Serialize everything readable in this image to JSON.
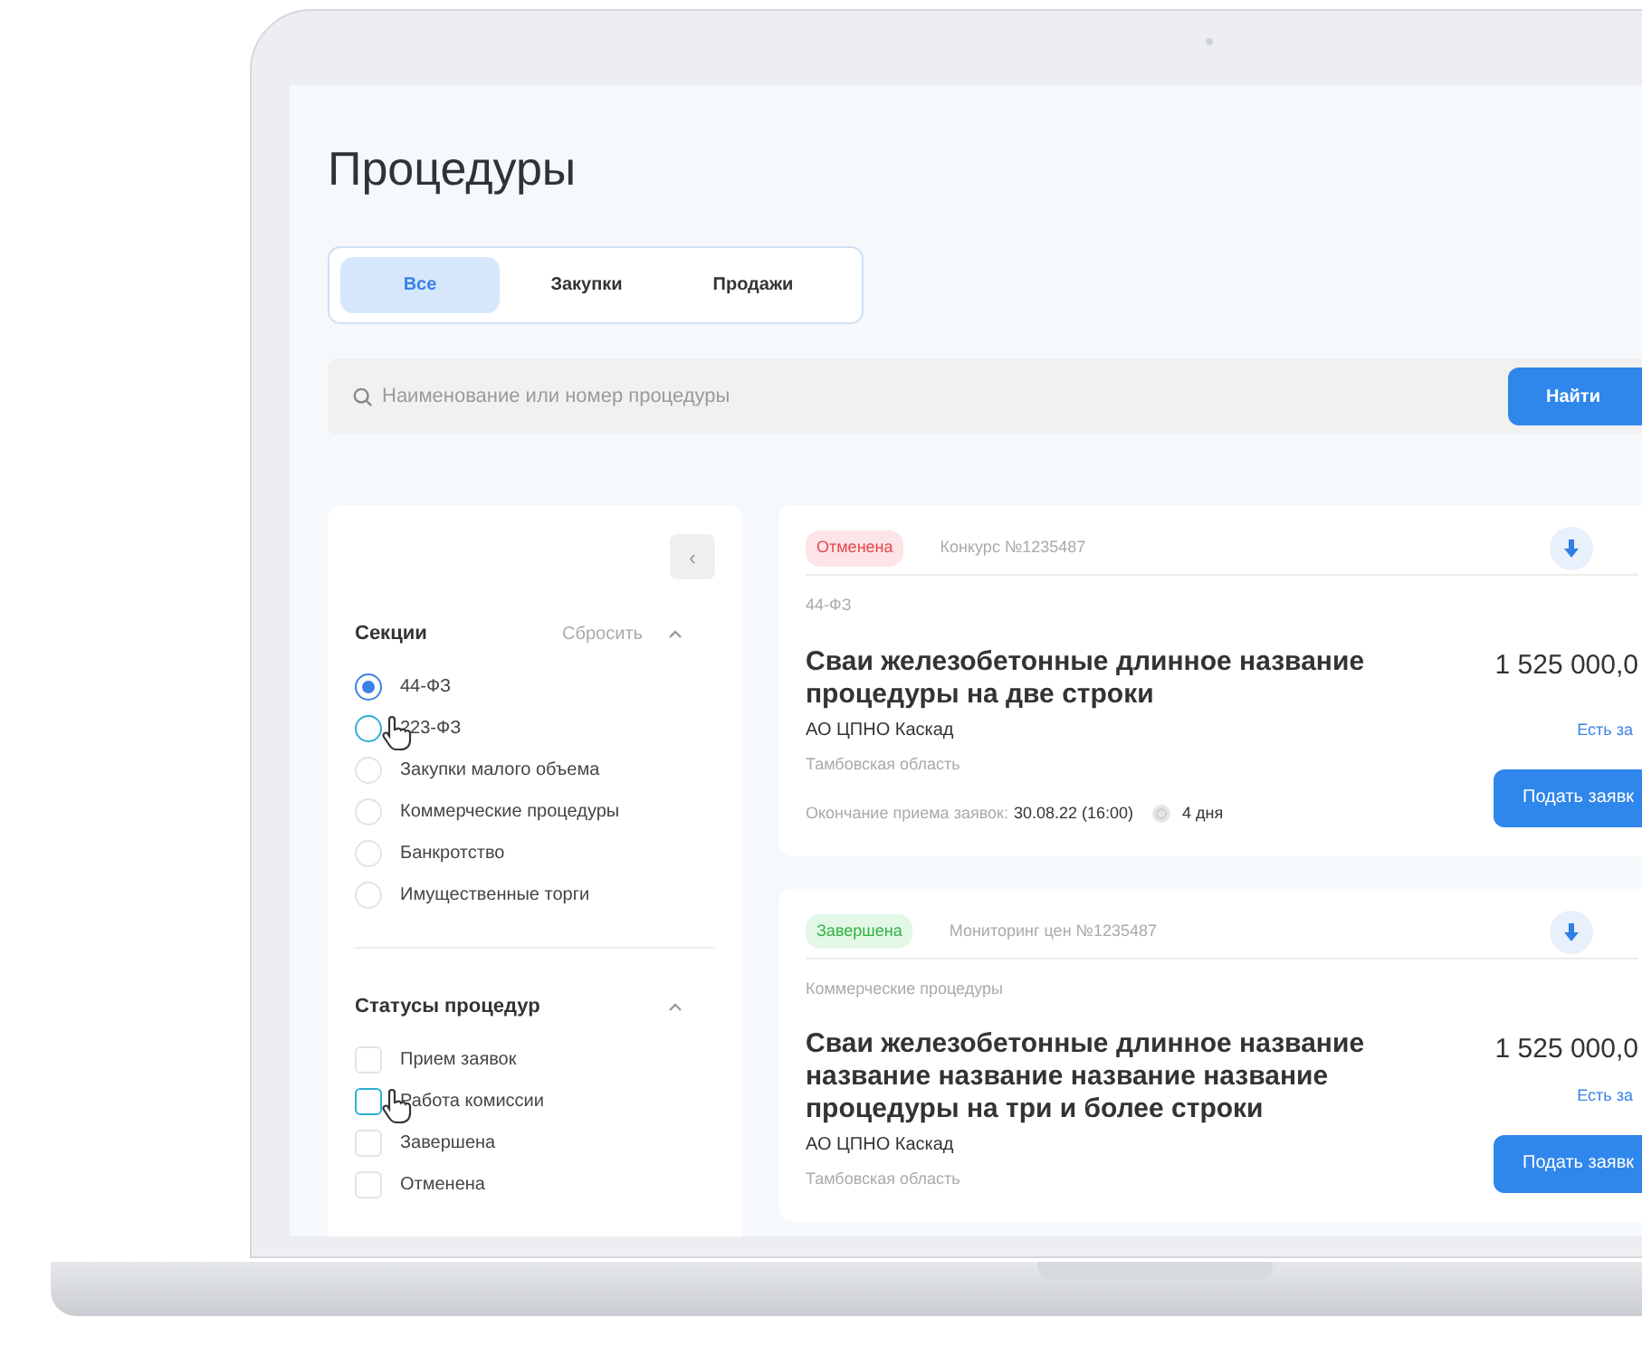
{
  "page": {
    "title": "Процедуры"
  },
  "tabs": [
    {
      "label": "Все",
      "selected": true
    },
    {
      "label": "Закупки",
      "selected": false
    },
    {
      "label": "Продажи",
      "selected": false
    }
  ],
  "search": {
    "placeholder": "Наименование или номер процедуры",
    "button": "Найти"
  },
  "filters": {
    "collapse_button": "‹",
    "sections": [
      {
        "title": "Секции",
        "reset": "Сбросить",
        "kind": "radio",
        "expanded": true,
        "items": [
          {
            "label": "44-ФЗ",
            "selected": true,
            "hovered": false
          },
          {
            "label": "223-ФЗ",
            "selected": false,
            "hovered": true
          },
          {
            "label": "Закупки малого объема",
            "selected": false,
            "hovered": false
          },
          {
            "label": "Коммерческие процедуры",
            "selected": false,
            "hovered": false
          },
          {
            "label": "Банкротство",
            "selected": false,
            "hovered": false
          },
          {
            "label": "Имущественные торги",
            "selected": false,
            "hovered": false
          }
        ]
      },
      {
        "title": "Статусы процедур",
        "kind": "checkbox",
        "expanded": true,
        "items": [
          {
            "label": "Прием заявок",
            "checked": false,
            "hovered": false
          },
          {
            "label": "Работа комиссии",
            "checked": false,
            "hovered": true
          },
          {
            "label": "Завершена",
            "checked": false,
            "hovered": false
          },
          {
            "label": "Отменена",
            "checked": false,
            "hovered": false
          }
        ]
      }
    ]
  },
  "procedures": [
    {
      "status": "Отменена",
      "color": "#e5484d",
      "type": "Конкурс №1235487",
      "section": "44-ФЗ",
      "title": "Сваи железобетонные длинное название процедуры на две строки",
      "organization": "АО ЦПНО Каскад",
      "region": "Тамбовская область",
      "price": "1 525 000,0",
      "bids": "Есть за",
      "action": "Подать заявк",
      "deadline_label": "Окончание приема заявок:",
      "deadline": "30.08.22 (16:00)",
      "remaining": "4 дня"
    },
    {
      "status": "Завершена",
      "color": "#2fb344",
      "type": "Мониторинг цен №1235487",
      "section": "Коммерческие процедуры",
      "title": "Сваи железобетонные длинное название название название название название процедуры на три и более строки",
      "organization": "АО ЦПНО Каскад",
      "region": "Тамбовская область",
      "price": "1 525 000,0",
      "bids": "Есть за",
      "action": "Подать заявк"
    }
  ]
}
